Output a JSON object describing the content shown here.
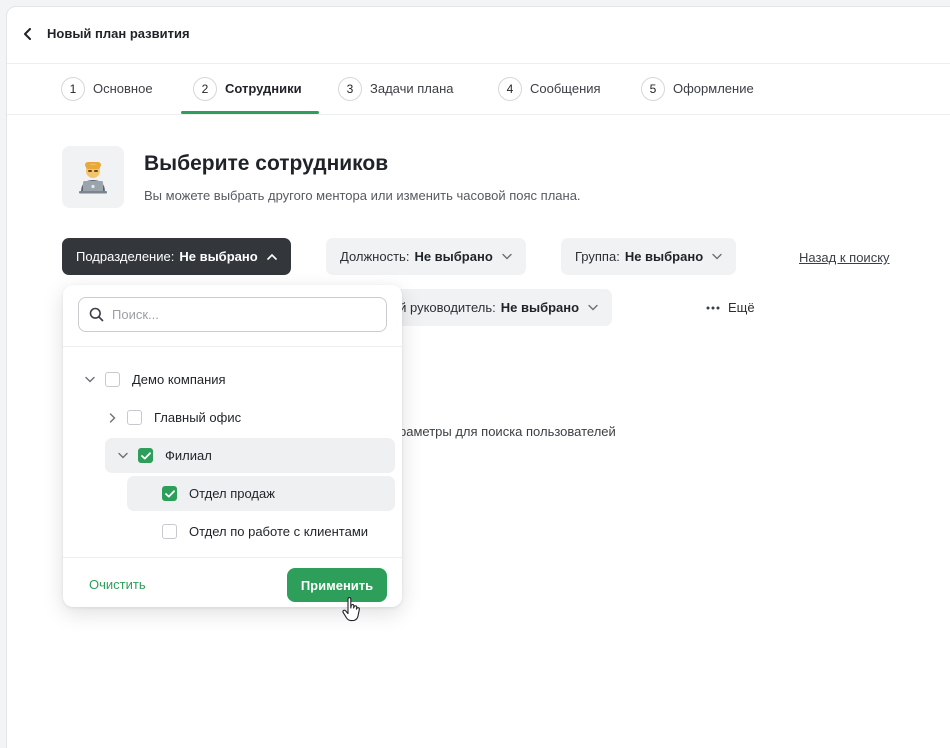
{
  "topbar": {
    "title": "Новый план развития",
    "back_icon": "chevron-left-icon"
  },
  "steps": [
    {
      "num": "1",
      "label": "Основное",
      "active": false
    },
    {
      "num": "2",
      "label": "Сотрудники",
      "active": true
    },
    {
      "num": "3",
      "label": "Задачи плана",
      "active": false
    },
    {
      "num": "4",
      "label": "Сообщения",
      "active": false
    },
    {
      "num": "5",
      "label": "Оформление",
      "active": false
    }
  ],
  "hero": {
    "title": "Выберите сотрудников",
    "subtitle": "Вы можете выбрать другого ментора или изменить часовой пояс плана.",
    "icon": "person-laptop-icon"
  },
  "filters": {
    "department": {
      "label": "Подразделение:",
      "value": "Не выбрано"
    },
    "position": {
      "label": "Должность:",
      "value": "Не выбрано"
    },
    "group": {
      "label": "Группа:",
      "value": "Не выбрано"
    },
    "manager": {
      "label": "альный руководитель:",
      "value": "Не выбрано"
    },
    "more": "Ещё",
    "back_to_search": "Назад к поиску"
  },
  "empty_hint": "раметры для поиска пользователей",
  "dropdown": {
    "search_placeholder": "Поиск...",
    "tree": [
      {
        "label": "Демо компания",
        "checked": false,
        "expanded": true
      },
      {
        "label": "Главный офис",
        "checked": false,
        "expanded": false
      },
      {
        "label": "Филиал",
        "checked": true,
        "expanded": true
      },
      {
        "label": "Отдел продаж",
        "checked": true
      },
      {
        "label": "Отдел по работе с клиентами",
        "checked": false
      }
    ],
    "clear_label": "Очистить",
    "apply_label": "Применить"
  },
  "colors": {
    "accent": "#2e9e5b",
    "dark_chip": "#33363b",
    "chip_bg": "#f1f2f4"
  }
}
